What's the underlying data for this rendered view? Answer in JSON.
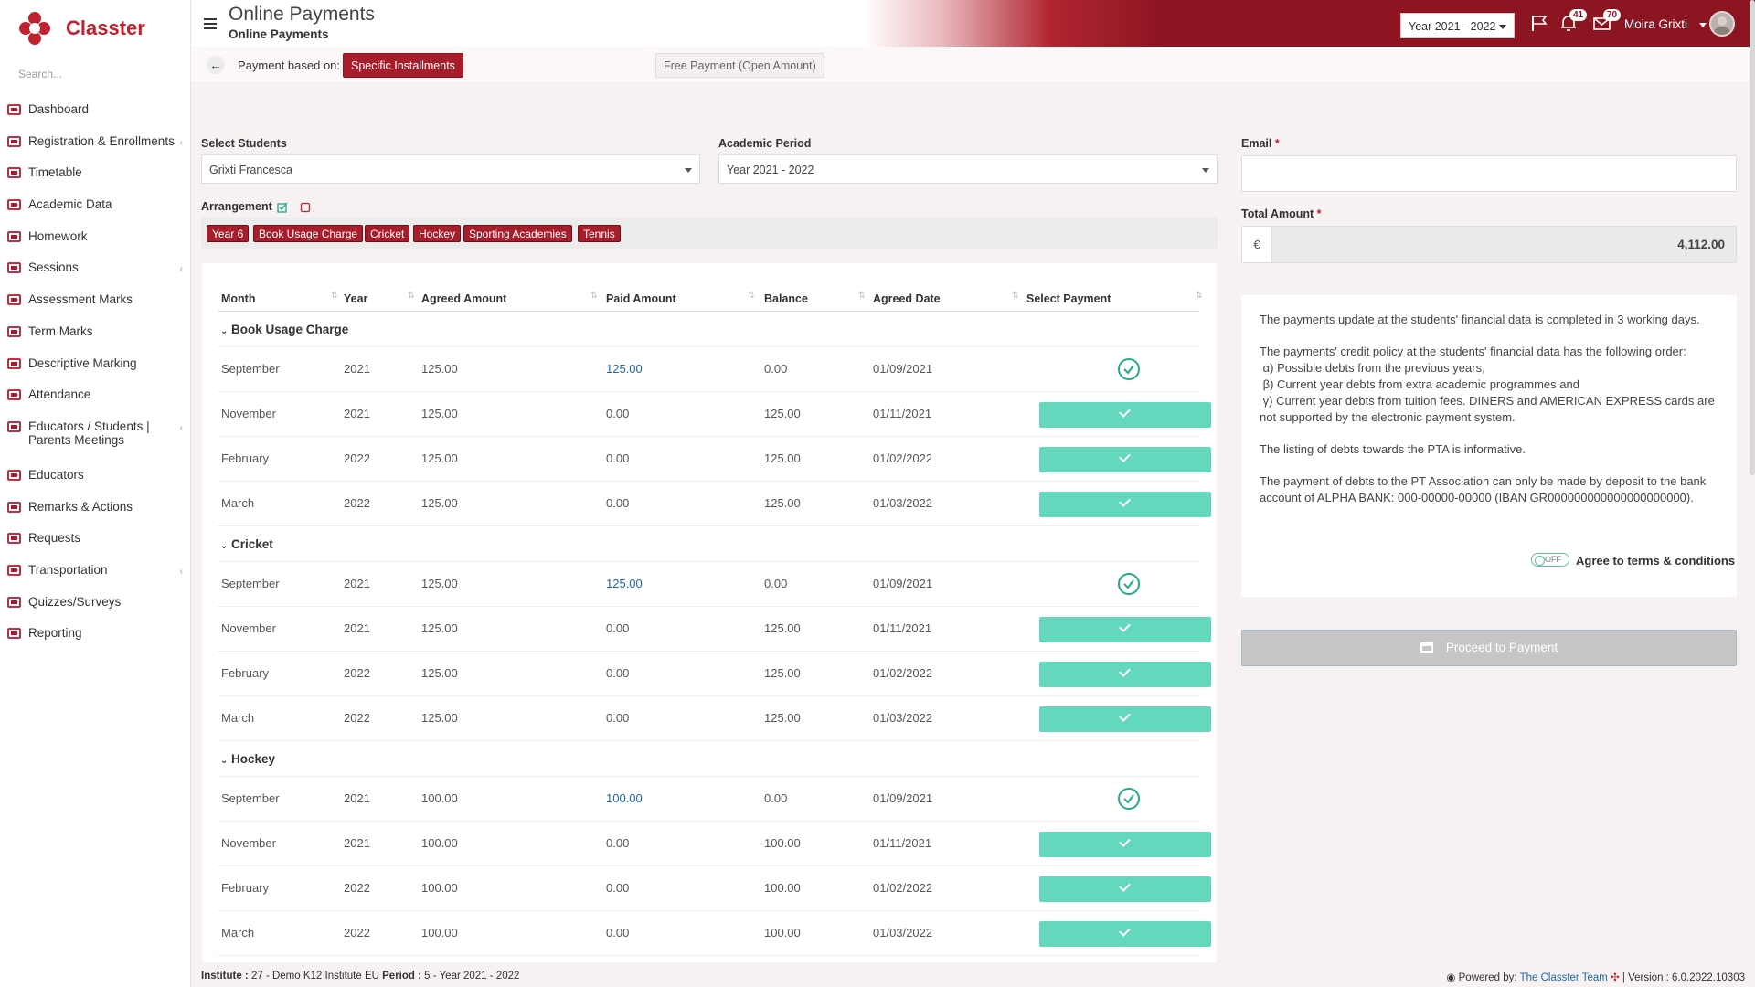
{
  "app": {
    "name": "Classter",
    "search_placeholder": "Search..."
  },
  "sidebar": {
    "items": [
      {
        "label": "Dashboard",
        "icon": "laptop-icon",
        "has_children": false
      },
      {
        "label": "Registration & Enrollments",
        "icon": "institution-icon",
        "has_children": true
      },
      {
        "label": "Timetable",
        "icon": "calendar-icon",
        "has_children": false
      },
      {
        "label": "Academic Data",
        "icon": "user-data-icon",
        "has_children": false
      },
      {
        "label": "Homework",
        "icon": "list-icon",
        "has_children": false
      },
      {
        "label": "Sessions",
        "icon": "users-icon",
        "has_children": true
      },
      {
        "label": "Assessment Marks",
        "icon": "edit-icon",
        "has_children": false
      },
      {
        "label": "Term Marks",
        "icon": "book-icon",
        "has_children": false
      },
      {
        "label": "Descriptive Marking",
        "icon": "pencil-square-icon",
        "has_children": false
      },
      {
        "label": "Attendance",
        "icon": "user-check-icon",
        "has_children": false
      },
      {
        "label": "Educators / Students | Parents Meetings",
        "icon": "meeting-icon",
        "has_children": true
      },
      {
        "label": "Educators",
        "icon": "educators-icon",
        "has_children": false
      },
      {
        "label": "Remarks & Actions",
        "icon": "remarks-icon",
        "has_children": false
      },
      {
        "label": "Requests",
        "icon": "document-icon",
        "has_children": false
      },
      {
        "label": "Transportation",
        "icon": "bus-icon",
        "has_children": true
      },
      {
        "label": "Quizzes/Surveys",
        "icon": "quiz-icon",
        "has_children": false
      },
      {
        "label": "Reporting",
        "icon": "printer-icon",
        "has_children": false
      }
    ]
  },
  "header": {
    "title": "Online Payments",
    "subtitle": "Online Payments",
    "year_select": "Year 2021 - 2022",
    "notifications_count": "41",
    "messages_count": "70",
    "user_name": "Moira Grixti"
  },
  "subbar": {
    "label": "Payment based on:",
    "tabs": [
      "Specific Installments",
      "Free Payment (Open Amount)"
    ],
    "active_tab": "Specific Installments"
  },
  "form": {
    "students_label": "Select Students",
    "students_value": "Grixti Francesca",
    "period_label": "Academic Period",
    "period_value": "Year 2021 - 2022",
    "arrangement_label": "Arrangement",
    "tags": [
      "Year 6",
      "Book Usage Charge",
      "Cricket",
      "Hockey",
      "Sporting Academies",
      "Tennis"
    ]
  },
  "table": {
    "columns": [
      "Month",
      "Year",
      "Agreed Amount",
      "Paid Amount",
      "Balance",
      "Agreed Date",
      "Select Payment"
    ],
    "groups": [
      {
        "name": "Book Usage Charge",
        "rows": [
          {
            "month": "September",
            "year": "2021",
            "agreed": "125.00",
            "paid": "125.00",
            "balance": "0.00",
            "date": "01/09/2021",
            "paid_in_full": true
          },
          {
            "month": "November",
            "year": "2021",
            "agreed": "125.00",
            "paid": "0.00",
            "balance": "125.00",
            "date": "01/11/2021",
            "paid_in_full": false
          },
          {
            "month": "February",
            "year": "2022",
            "agreed": "125.00",
            "paid": "0.00",
            "balance": "125.00",
            "date": "01/02/2022",
            "paid_in_full": false
          },
          {
            "month": "March",
            "year": "2022",
            "agreed": "125.00",
            "paid": "0.00",
            "balance": "125.00",
            "date": "01/03/2022",
            "paid_in_full": false
          }
        ]
      },
      {
        "name": "Cricket",
        "rows": [
          {
            "month": "September",
            "year": "2021",
            "agreed": "125.00",
            "paid": "125.00",
            "balance": "0.00",
            "date": "01/09/2021",
            "paid_in_full": true
          },
          {
            "month": "November",
            "year": "2021",
            "agreed": "125.00",
            "paid": "0.00",
            "balance": "125.00",
            "date": "01/11/2021",
            "paid_in_full": false
          },
          {
            "month": "February",
            "year": "2022",
            "agreed": "125.00",
            "paid": "0.00",
            "balance": "125.00",
            "date": "01/02/2022",
            "paid_in_full": false
          },
          {
            "month": "March",
            "year": "2022",
            "agreed": "125.00",
            "paid": "0.00",
            "balance": "125.00",
            "date": "01/03/2022",
            "paid_in_full": false
          }
        ]
      },
      {
        "name": "Hockey",
        "rows": [
          {
            "month": "September",
            "year": "2021",
            "agreed": "100.00",
            "paid": "100.00",
            "balance": "0.00",
            "date": "01/09/2021",
            "paid_in_full": true
          },
          {
            "month": "November",
            "year": "2021",
            "agreed": "100.00",
            "paid": "0.00",
            "balance": "100.00",
            "date": "01/11/2021",
            "paid_in_full": false
          },
          {
            "month": "February",
            "year": "2022",
            "agreed": "100.00",
            "paid": "0.00",
            "balance": "100.00",
            "date": "01/02/2022",
            "paid_in_full": false
          },
          {
            "month": "March",
            "year": "2022",
            "agreed": "100.00",
            "paid": "0.00",
            "balance": "100.00",
            "date": "01/03/2022",
            "paid_in_full": false
          }
        ]
      }
    ]
  },
  "right": {
    "email_label": "Email",
    "total_label": "Total Amount",
    "currency": "€",
    "total_value": "4,112.00",
    "info_paragraphs": [
      "The payments update at the students' financial data is completed in 3 working days.",
      "The payments' credit policy at the students' financial data has the following order:",
      "The listing of debts towards the PTA is informative.",
      "The payment of debts to the PT Association can only be made by deposit to the bank account of ALPHA BANK: 000-00000-00000 (IBAN GR000000000000000000000)."
    ],
    "policy_items": [
      "α) Possible debts from the previous years,",
      "β) Current year debts from extra academic programmes and",
      "γ) Current year debts from tuition fees. DINERS and AMERICAN EXPRESS cards are not supported by the electronic payment system."
    ],
    "toggle_label": "OFF",
    "agree_label": "Agree to terms & conditions",
    "proceed_label": "Proceed to Payment"
  },
  "footer": {
    "institute_label": "Institute :",
    "institute_value": "27 - Demo K12 Institute EU",
    "period_label": "Period :",
    "period_value": "5 - Year 2021 - 2022",
    "powered_label": "Powered by:",
    "powered_link": "The Classter Team",
    "version": "| Version : 6.0.2022.10303"
  },
  "colors": {
    "brand": "#a81d2b",
    "accent_teal": "#63d8bd",
    "link": "#1c67a8"
  }
}
